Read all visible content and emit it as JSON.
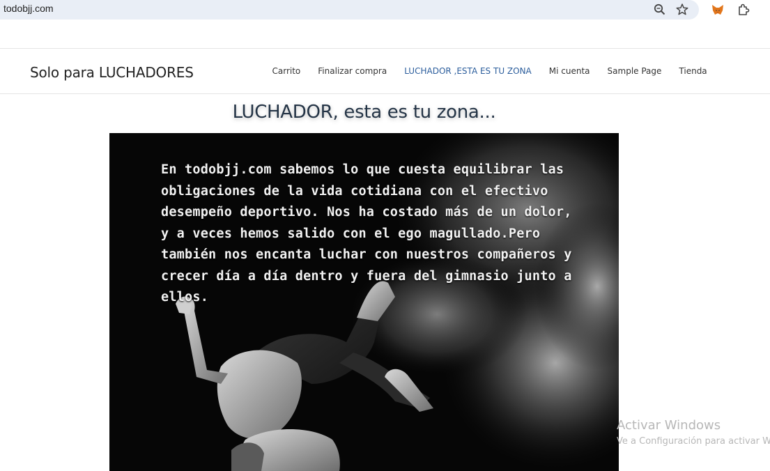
{
  "browser": {
    "url": "todobjj.com",
    "icons": [
      "zoom-icon",
      "bookmark-star-icon",
      "metamask-fox-icon",
      "extensions-puzzle-icon"
    ]
  },
  "site": {
    "title": "Solo para LUCHADORES",
    "nav": [
      {
        "label": "Carrito"
      },
      {
        "label": "Finalizar compra"
      },
      {
        "label": "LUCHADOR ,ESTA ES TU ZONA"
      },
      {
        "label": "Mi cuenta"
      },
      {
        "label": "Sample Page"
      },
      {
        "label": "Tienda"
      }
    ],
    "active_nav": "LUCHADOR ,ESTA ES TU ZONA",
    "accent": "#2b5d9c"
  },
  "main": {
    "heading": "LUCHADOR, esta es tu zona...",
    "hero_text": "En todobjj.com sabemos lo que cuesta equilibrar las obligaciones de la vida cotidiana con el efectivo desempeño deportivo. Nos ha costado más de un dolor, y a veces hemos salido con el ego magullado.Pero también nos encanta luchar con nuestros compañeros y crecer día a día dentro y fuera del gimnasio junto a ellos."
  },
  "watermark": {
    "title": "Activar Windows",
    "subtitle": "Ve a Configuración para activar W"
  }
}
